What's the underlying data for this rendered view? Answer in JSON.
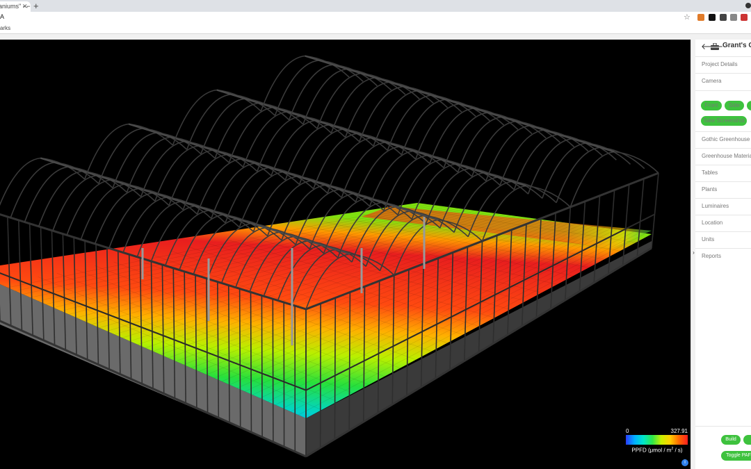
{
  "browser": {
    "tab_title": "aniums\" - ⌐",
    "tab_close": "✕",
    "new_tab": "+",
    "url_fragment": "A",
    "bookmark_fragment": "arks",
    "star": "☆"
  },
  "legend": {
    "min": "0",
    "max": "327.91",
    "label_prefix": "PPFD (μmol / m",
    "label_exp": "2",
    "label_suffix": " / s)"
  },
  "panel": {
    "title": "Grant's Ge",
    "back": "🡐",
    "sections": {
      "project_details": "Project Details",
      "camera": "Camera",
      "gothic": "Gothic Greenhouse D",
      "materials": "Greenhouse Materials",
      "tables": "Tables",
      "plants": "Plants",
      "luminaires": "Luminaires",
      "location": "Location",
      "units": "Units",
      "reports": "Reports"
    },
    "camera_buttons": {
      "front": "Front",
      "side": "Side",
      "screenshot": "Take Screenshot"
    },
    "footer_buttons": {
      "build": "Build",
      "toggle_par": "Toggle PAF"
    }
  },
  "colors": {
    "accent_green": "#3ec23e",
    "viewport_bg": "#000000",
    "info_blue": "#2f80ed"
  },
  "icons": [
    "back-arrow-icon",
    "toolbox-icon",
    "info-icon",
    "collapse-arrow-icon",
    "star-icon"
  ]
}
